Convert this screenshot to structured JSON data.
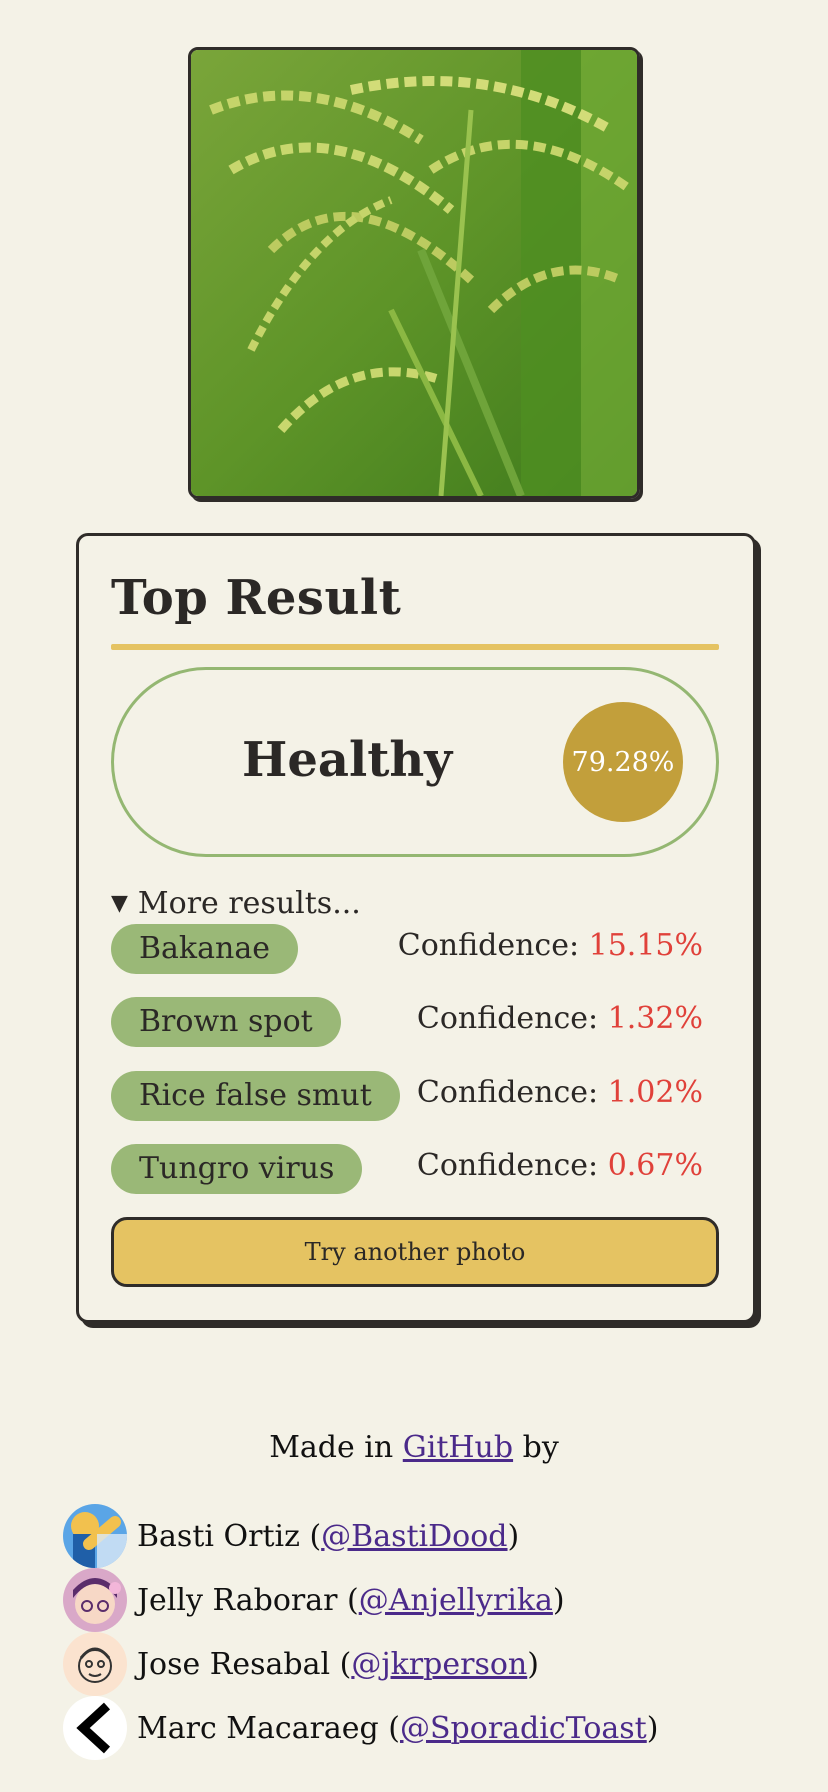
{
  "card": {
    "title": "Top Result",
    "top": {
      "label": "Healthy",
      "confidence": "79.28%"
    },
    "more_label": "More results...",
    "caret": "▼",
    "results": [
      {
        "label": "Bakanae",
        "confidence_prefix": "Confidence: ",
        "confidence": "15.15%"
      },
      {
        "label": "Brown spot",
        "confidence_prefix": "Confidence: ",
        "confidence": "1.32%"
      },
      {
        "label": "Rice false smut",
        "confidence_prefix": "Confidence: ",
        "confidence": "1.02%"
      },
      {
        "label": "Tungro virus",
        "confidence_prefix": "Confidence: ",
        "confidence": "0.67%"
      }
    ],
    "button_label": "Try another photo"
  },
  "footer": {
    "made_prefix": "Made in ",
    "made_link": "GitHub",
    "made_suffix": " by",
    "credits": [
      {
        "name": "Basti Ortiz (",
        "handle": "@BastiDood",
        "close": ")",
        "avatar": "blue-yellow-avatar-icon"
      },
      {
        "name": "Jelly Raborar (",
        "handle": "@Anjellyrika",
        "close": ")",
        "avatar": "cartoon-girl-avatar-icon"
      },
      {
        "name": "Jose Resabal (",
        "handle": "@jkrperson",
        "close": ")",
        "avatar": "cartoon-face-avatar-icon"
      },
      {
        "name": "Marc Macaraeg (",
        "handle": "@SporadicToast",
        "close": ")",
        "avatar": "chevron-left-avatar-icon"
      }
    ]
  },
  "colors": {
    "background": "#f4f2e7",
    "accent_yellow": "#e5c362",
    "chip_green": "#9ab877",
    "badge_gold": "#c29f3b",
    "confidence_red": "#e0413a",
    "link_purple": "#4b2a8a"
  }
}
